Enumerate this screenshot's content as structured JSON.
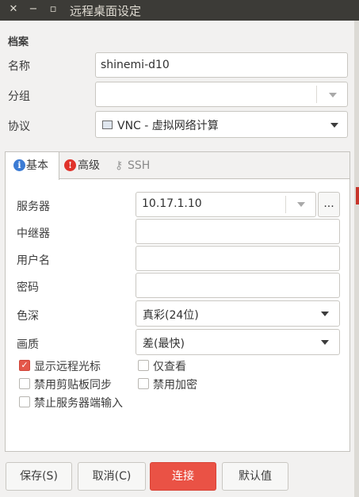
{
  "window": {
    "title": "远程桌面设定",
    "close_glyph": "✕",
    "minimize_glyph": "−",
    "maximize_glyph": "▫"
  },
  "profile": {
    "section_title": "档案",
    "name_label": "名称",
    "name_value": "shinemi-d10",
    "group_label": "分组",
    "group_value": "",
    "protocol_label": "协议",
    "protocol_value": "VNC - 虚拟网络计算"
  },
  "tabs": [
    {
      "label": "基本",
      "icon": "info-icon",
      "glyph": "i",
      "color": "#3b7bd4"
    },
    {
      "label": "高级",
      "icon": "warning-icon",
      "glyph": "!",
      "color": "#e0332b"
    },
    {
      "label": "SSH",
      "icon": "key-icon",
      "glyph": "⚷",
      "color": "#9a9a9a"
    }
  ],
  "basic": {
    "server_label": "服务器",
    "server_value": "10.17.1.10",
    "server_more": "...",
    "repeater_label": "中继器",
    "repeater_value": "",
    "username_label": "用户名",
    "username_value": "",
    "password_label": "密码",
    "password_value": "",
    "colordepth_label": "色深",
    "colordepth_value": "真彩(24位)",
    "quality_label": "画质",
    "quality_value": "差(最快)"
  },
  "options": {
    "show_cursor": {
      "label": "显示远程光标",
      "checked": true
    },
    "view_only": {
      "label": "仅查看",
      "checked": false
    },
    "disable_clipboard": {
      "label": "禁用剪贴板同步",
      "checked": false
    },
    "disable_encryption": {
      "label": "禁用加密",
      "checked": false
    },
    "disable_input": {
      "label": "禁止服务器端输入",
      "checked": false
    }
  },
  "buttons": {
    "save": "保存(S)",
    "cancel": "取消(C)",
    "connect": "连接",
    "default": "默认值"
  },
  "colors": {
    "accent": "#ea5245",
    "titlebar": "#3c3b37"
  }
}
